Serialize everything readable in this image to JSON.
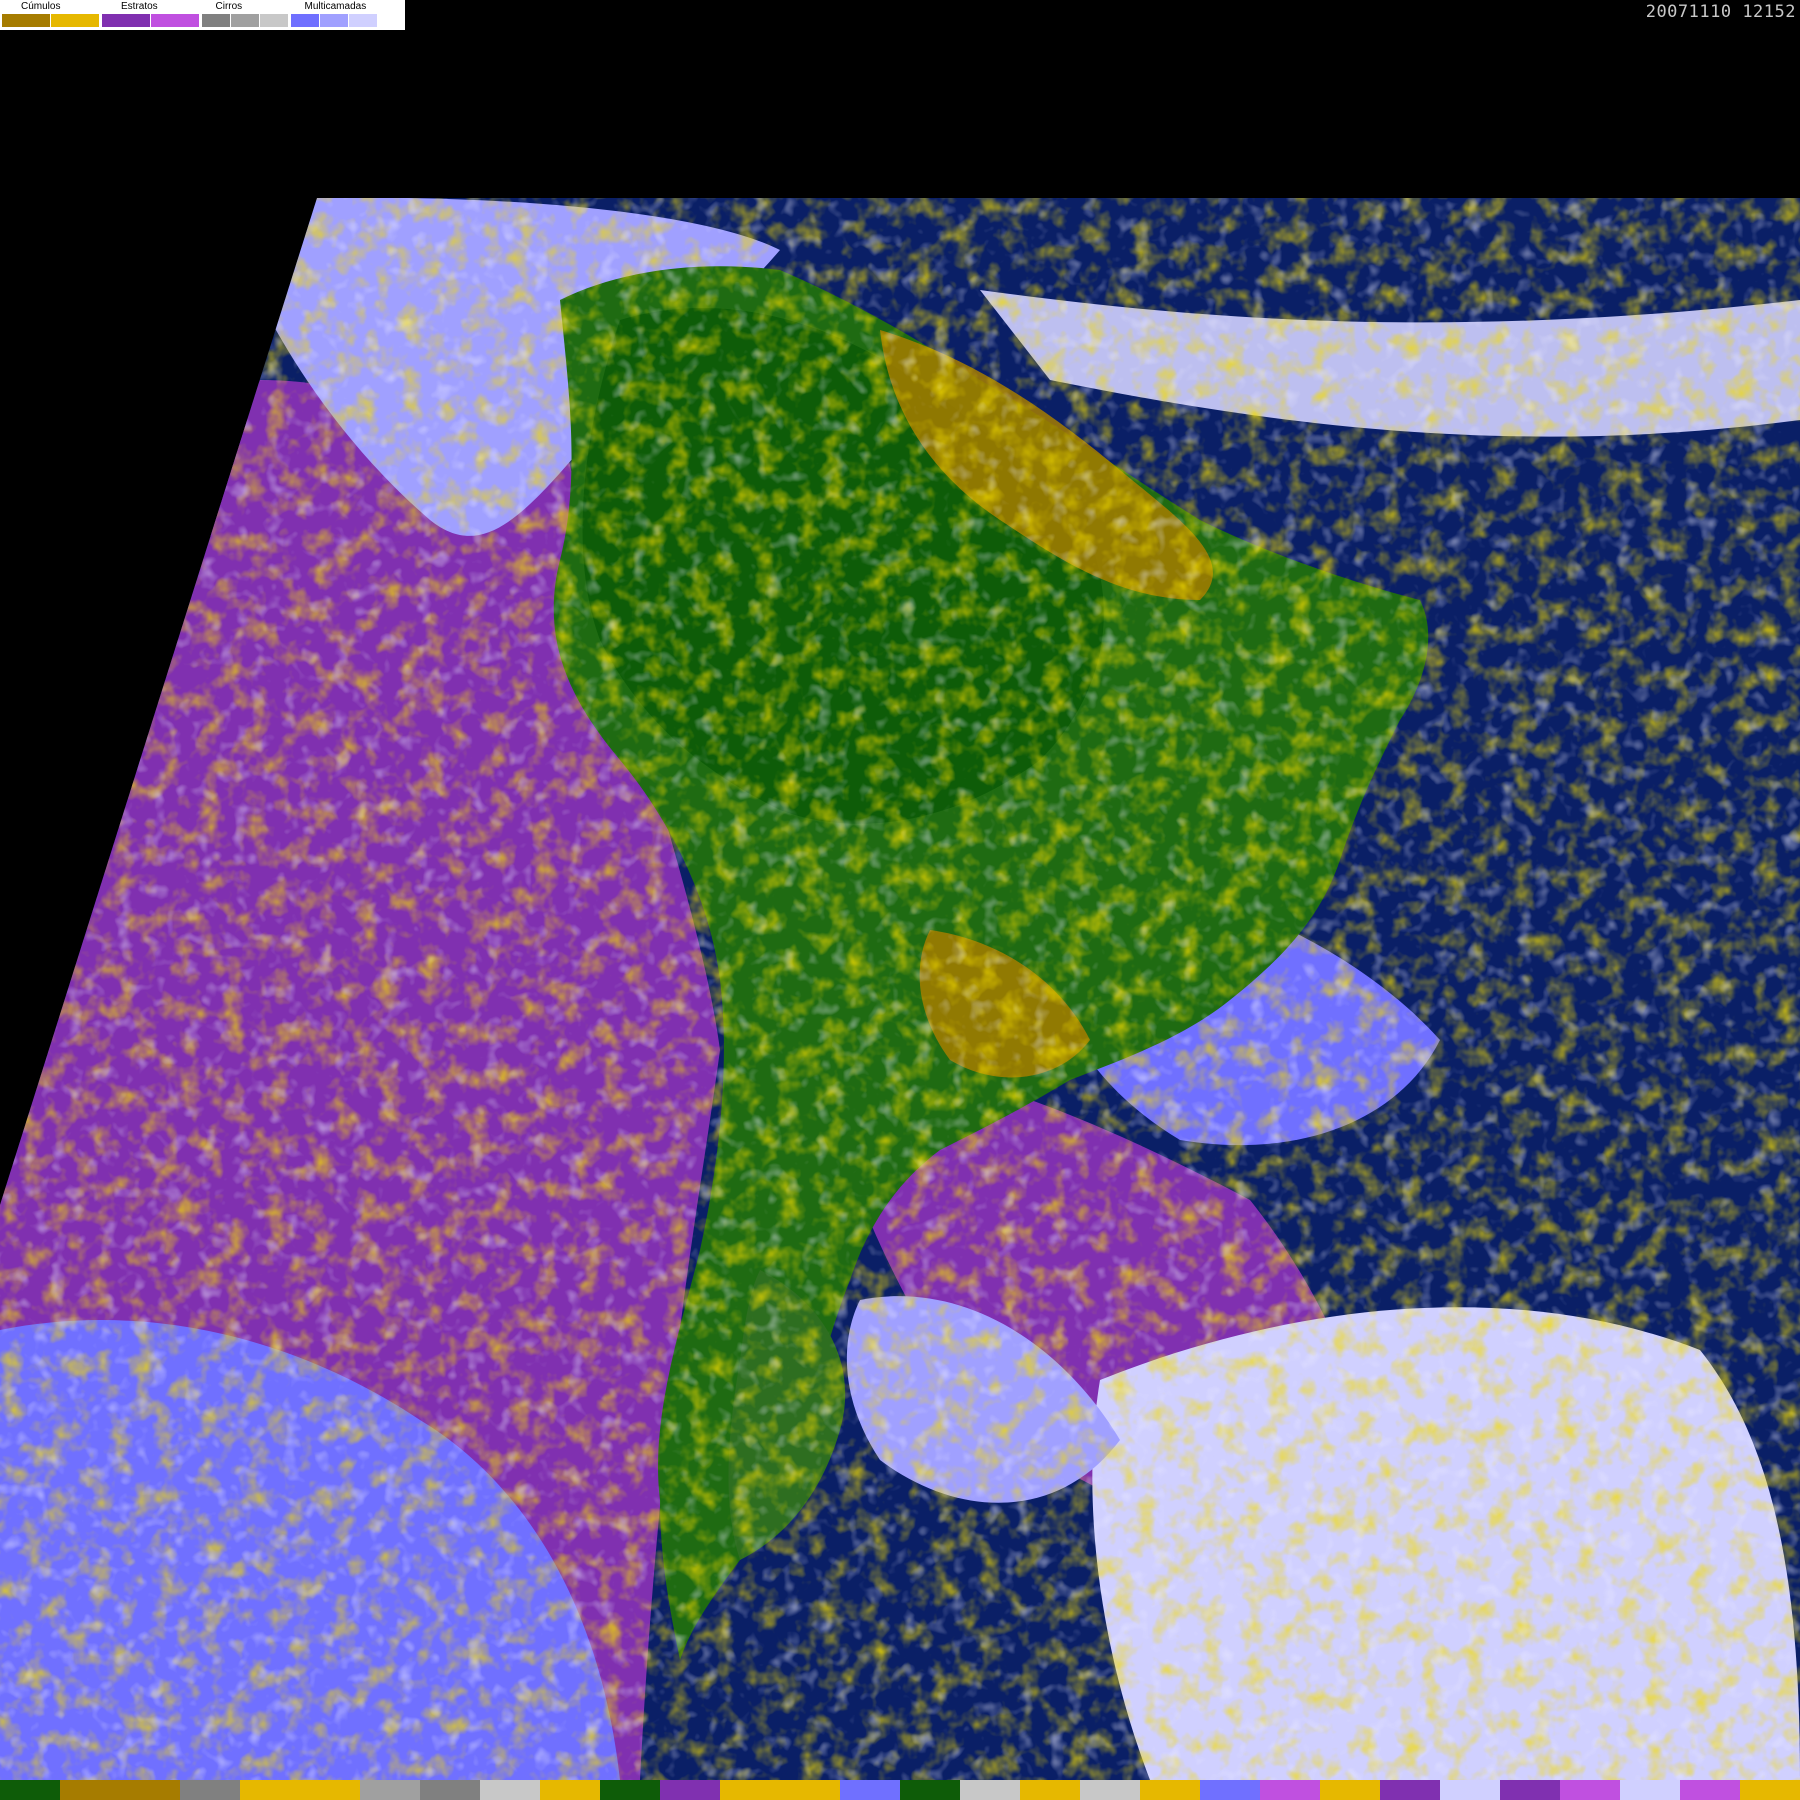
{
  "legend": {
    "groups": [
      {
        "label": "Cúmulos",
        "colors": [
          "#a67c00",
          "#e6b800"
        ]
      },
      {
        "label": "Estratos",
        "colors": [
          "#8030b0",
          "#c050e0"
        ]
      },
      {
        "label": "Cirros",
        "colors": [
          "#808080",
          "#a0a0a0",
          "#c8c8c8"
        ]
      },
      {
        "label": "Multicamadas",
        "colors": [
          "#7070ff",
          "#a0a0ff",
          "#d0d0ff"
        ]
      }
    ]
  },
  "timestamp": "20071110 12152",
  "colors": {
    "ocean": "#0a1f66",
    "land": "#1f6b12",
    "land_dark": "#0e5c08",
    "cumulus_dark": "#a67c00",
    "cumulus_light": "#e6b800",
    "stratus_dark": "#8030b0",
    "stratus_light": "#c050e0",
    "cirrus": "#b0b0b0",
    "multilayer_dark": "#7070ff",
    "multilayer_mid": "#a0a0ff",
    "multilayer_light": "#d0d0ff"
  },
  "bottom_palette": [
    "#0e5c08",
    "#a67c00",
    "#a67c00",
    "#808080",
    "#e6b800",
    "#e6b800",
    "#a0a0a0",
    "#808080",
    "#c8c8c8",
    "#e6b800",
    "#0e5c08",
    "#8030b0",
    "#e6b800",
    "#e6b800",
    "#7070ff",
    "#0e5c08",
    "#c8c8c8",
    "#e6b800",
    "#c8c8c8",
    "#e6b800",
    "#7070ff",
    "#c050e0",
    "#e6b800",
    "#8030b0",
    "#d0d0ff",
    "#8030b0",
    "#c050e0",
    "#d0d0ff",
    "#c050e0",
    "#e6b800"
  ]
}
